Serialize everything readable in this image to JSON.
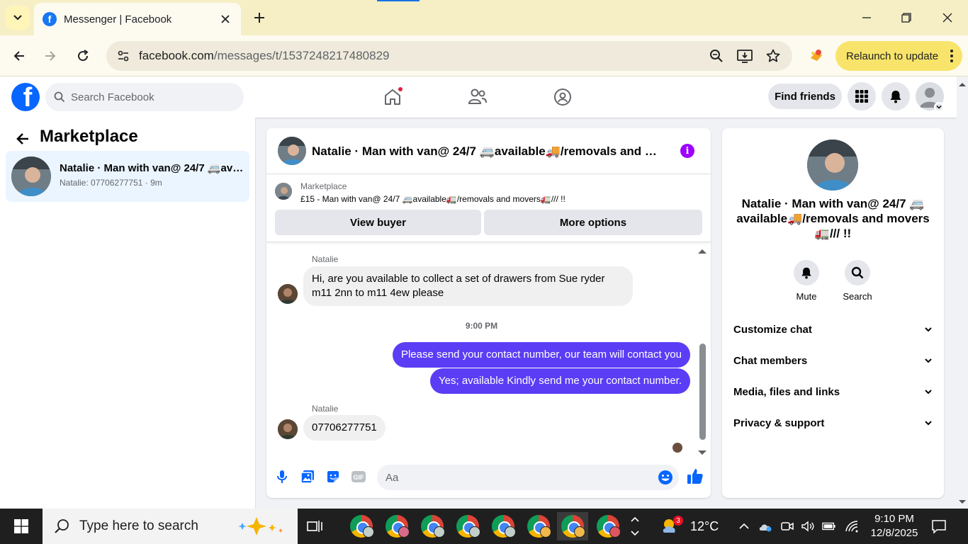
{
  "browser": {
    "tab_title": "Messenger | Facebook",
    "url_domain": "facebook.com",
    "url_path": "/messages/t/1537248217480829",
    "relaunch_label": "Relaunch to update"
  },
  "fb_header": {
    "logo_letter": "f",
    "search_placeholder": "Search Facebook",
    "find_friends_label": "Find friends"
  },
  "sidebar": {
    "heading": "Marketplace",
    "conversations": [
      {
        "name": "Natalie · Man with van@ 24/7 🚐available🚚/removals and movers🚛/// !!",
        "preview": "Natalie: 07706277751 · 9m"
      }
    ]
  },
  "chat": {
    "title": "Natalie · Man with van@ 24/7 🚐available🚚/removals and movers🚛/// !!",
    "marketplace": {
      "label": "Marketplace",
      "listing": "£15 - Man with van@ 24/7 🚐available🚛/removals and movers🚛/// !!",
      "view_buyer_label": "View buyer",
      "more_options_label": "More options"
    },
    "messages": [
      {
        "sender": "Natalie",
        "direction": "in",
        "text": "Hi, are you available to collect a set of drawers from Sue ryder m11 2nn to m11 4ew please"
      },
      {
        "timestamp": "9:00 PM"
      },
      {
        "direction": "out",
        "text": "Please send your contact number, our team will contact you"
      },
      {
        "direction": "out",
        "text": "Yes; available Kindly send me your contact number."
      },
      {
        "sender": "Natalie",
        "direction": "in",
        "text": "07706277751"
      }
    ],
    "input_placeholder": "Aa"
  },
  "info_panel": {
    "name": "Natalie · Man with van@ 24/7 🚐 available🚚/removals and movers 🚛/// !!",
    "actions": [
      {
        "label": "Mute",
        "icon": "bell-icon"
      },
      {
        "label": "Search",
        "icon": "search-icon"
      }
    ],
    "sections": [
      "Customize chat",
      "Chat members",
      "Media, files and links",
      "Privacy & support"
    ]
  },
  "taskbar": {
    "search_placeholder": "Type here to search",
    "weather_badge": "3",
    "temperature": "12°C",
    "time": "9:10 PM",
    "date": "12/8/2025"
  },
  "colors": {
    "fb_blue": "#0866ff",
    "outgoing_bubble": "#5b3df5",
    "info_purple": "#9d00ff",
    "relaunch_yellow": "#f8e46a",
    "selected_conv": "#ebf5ff"
  }
}
